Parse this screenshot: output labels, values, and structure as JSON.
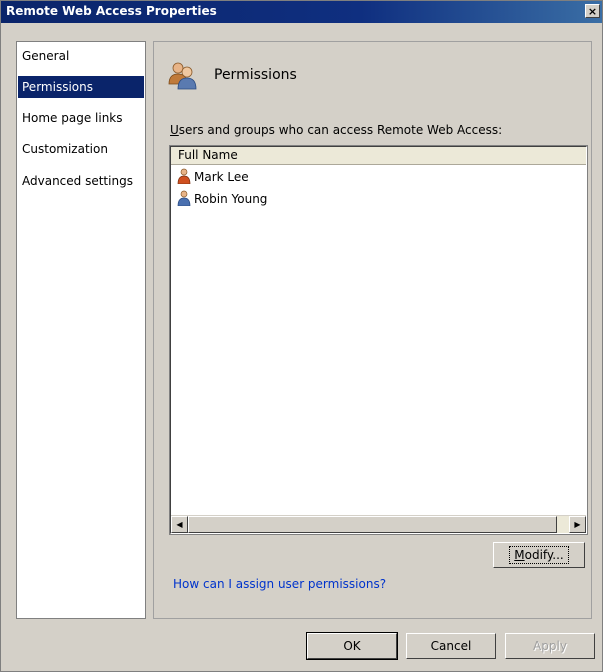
{
  "window": {
    "title": "Remote Web Access Properties",
    "close_label": "×"
  },
  "nav": {
    "items": [
      {
        "label": "General",
        "selected": false
      },
      {
        "label": "Permissions",
        "selected": true
      },
      {
        "label": "Home page links",
        "selected": false
      },
      {
        "label": "Customization",
        "selected": false
      },
      {
        "label": "Advanced settings",
        "selected": false
      }
    ]
  },
  "content": {
    "title": "Permissions",
    "list_label_access_key": "U",
    "list_label_rest": "sers and groups who can access Remote Web Access:",
    "column_header": "Full Name",
    "users": [
      {
        "name": "Mark Lee",
        "icon": "user-admin-icon"
      },
      {
        "name": "Robin Young",
        "icon": "user-icon"
      }
    ],
    "modify_access_key": "M",
    "modify_rest": "odify...",
    "help_link": "How can I assign user permissions?"
  },
  "buttons": {
    "ok": "OK",
    "cancel": "Cancel",
    "apply": "Apply"
  },
  "colors": {
    "title_bar": "#0a246a",
    "selected_nav": "#0a246a",
    "link": "#0033cc"
  }
}
